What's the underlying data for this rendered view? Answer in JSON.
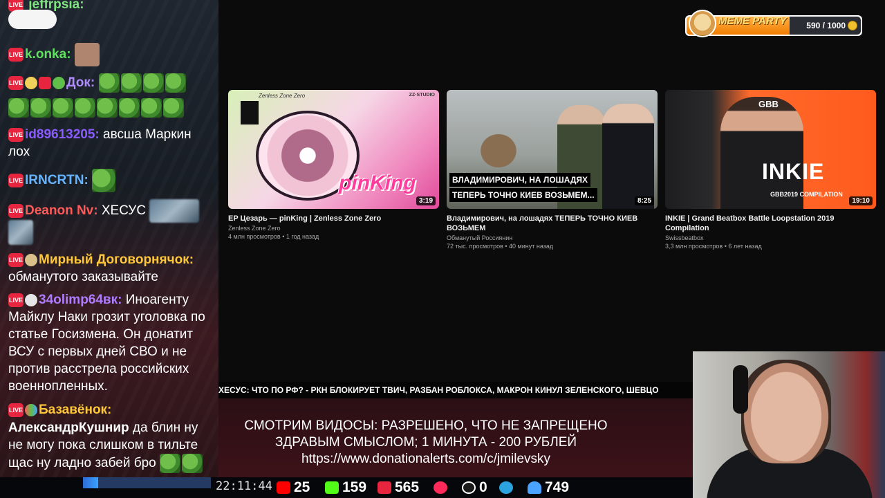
{
  "chat": {
    "messages": [
      {
        "user": "jeffrpsia:",
        "user_color": "#7fe37f",
        "text": ""
      },
      {
        "user": "k.onka:",
        "user_color": "#5fe05f",
        "text": ""
      },
      {
        "user": "Док:",
        "user_color": "#b08cff",
        "text": ""
      },
      {
        "user": "id89613205:",
        "user_color": "#8a5cff",
        "text": "авсша Маркин лох"
      },
      {
        "user": "IRNCRTN:",
        "user_color": "#66b3ff",
        "text": ""
      },
      {
        "user": "Deanon Nv:",
        "user_color": "#ff5a5a",
        "text": "ХЕСУС"
      },
      {
        "user": "Мирный Договорнячок:",
        "user_color": "#ffc83a",
        "text": "обманутого заказывайте"
      },
      {
        "user": "34olimp64вк:",
        "user_color": "#b07cff",
        "text": "Иноагенту Майклу Наки грозит уголовка по статье Госизмена. Он донатит ВСУ с первых дней СВО и не против расстрела российских военнопленных."
      },
      {
        "user": "Базавёнок:",
        "user_color": "#ffc83a",
        "text": ""
      },
      {
        "mention": "АлександрКушнир",
        "text": "да блин ну не могу пока слишком в тильте щас ну ладно забей бро"
      }
    ],
    "progress_fraction": 0.12
  },
  "goal": {
    "title": "MEME PARTY",
    "count": "590 / 1000",
    "fraction": 0.59
  },
  "videos": [
    {
      "title": "EP Цезарь — pinKing | Zenless Zone Zero",
      "channel": "Zenless Zone Zero",
      "meta": "4 млн просмотров • 1 год назад",
      "duration": "3:19",
      "thumb_logo": "pinKing",
      "thumb_brand": "Zenless Zone Zero",
      "thumb_studio": "ZZ·STUDIO"
    },
    {
      "title": "Владимирович, на лошадях ТЕПЕРЬ ТОЧНО КИЕВ ВОЗЬМЕМ",
      "channel": "Обманутый Россиянин",
      "meta": "72 тыс. просмотров • 40 минут назад",
      "duration": "8:25",
      "caption_line1": "ВЛАДИМИРОВИЧ, НА ЛОШАДЯХ",
      "caption_line2": "ТЕПЕРЬ ТОЧНО КИЕВ ВОЗЬМЕМ..."
    },
    {
      "title": "INKIE | Grand Beatbox Battle Loopstation 2019 Compilation",
      "channel": "Swissbeatbox",
      "meta": "3,3 млн просмотров • 6 лет назад",
      "duration": "19:10",
      "thumb_word": "INKIE",
      "thumb_sub": "GBB2019 COMPILATION",
      "thumb_gbb": "GBB"
    }
  ],
  "ticker": "ХЕСУС: ЧТО ПО РФ? - РКН БЛОКИРУЕТ ТВИЧ, РАЗБАН РОБЛОКСА, МАКРОН КИНУЛ ЗЕЛЕНСКОГО, ШЕВЦО",
  "rules": {
    "line1": "СМОТРИМ ВИДОСЫ: РАЗРЕШЕНО, ЧТО НЕ ЗАПРЕЩЕНО",
    "line2": "ЗДРАВЫМ СМЫСЛОМ; 1 МИНУТА - 200 РУБЛЕЙ",
    "line3": "https://www.donationalerts.com/c/jmilevsky"
  },
  "status": {
    "clock": "22:11:44",
    "youtube": "25",
    "kick": "159",
    "live": "565",
    "vk": "",
    "rumble": "0",
    "telegram": "",
    "viewers": "749"
  },
  "colors": {
    "youtube": "#ff0000",
    "kick": "#53fc18",
    "live": "#e8253f",
    "vk_video": "#ff2a5a",
    "telegram": "#2aa3df",
    "viewers": "#4aa3ff"
  }
}
